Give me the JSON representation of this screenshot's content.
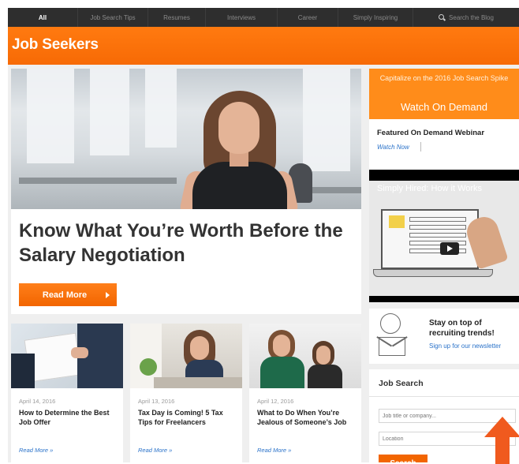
{
  "nav": {
    "items": [
      {
        "label": "All",
        "active": true
      },
      {
        "label": "Job Search Tips",
        "active": false
      },
      {
        "label": "Resumes",
        "active": false
      },
      {
        "label": "Interviews",
        "active": false
      },
      {
        "label": "Career",
        "active": false
      },
      {
        "label": "Simply Inspiring",
        "active": false
      }
    ],
    "search_label": "Search the Blog"
  },
  "banner": {
    "title": "Job Seekers"
  },
  "hero": {
    "title": "Know What You’re Worth Before the Salary Negotiation",
    "button_label": "Read More"
  },
  "cards": [
    {
      "date": "April 14, 2016",
      "title": "How to Determine the Best Job Offer",
      "link": "Read More »"
    },
    {
      "date": "April 13, 2016",
      "title": "Tax Day is Coming! 5 Tax Tips for Freelancers",
      "link": "Read More »"
    },
    {
      "date": "April 12, 2016",
      "title": "What to Do When You’re Jealous of Someone’s Job",
      "link": "Read More »"
    }
  ],
  "sidebar": {
    "ad": {
      "caption": "Capitalize on the 2016 Job Search Spike",
      "cta": "Watch On Demand",
      "heading": "Featured On Demand Webinar",
      "link": "Watch Now"
    },
    "video": {
      "title": "Simply Hired: How it Works"
    },
    "newsletter": {
      "text": "Stay on top of recruiting trends!",
      "link": "Sign up for our newsletter"
    },
    "job_search": {
      "heading": "Job Search",
      "title_placeholder": "Job title or company...",
      "location_placeholder": "Location",
      "button_label": "Search"
    }
  },
  "colors": {
    "brand_orange": "#f76a05",
    "nav_bg": "#2e2e2e",
    "link_blue": "#2a72c9",
    "cursor": "#f05a1e"
  },
  "icons": {
    "search": "magnifier-icon",
    "play": "play-icon",
    "newsletter": "envelope-icon",
    "badge": "badge-icon",
    "cursor": "arrow-cursor-icon"
  }
}
